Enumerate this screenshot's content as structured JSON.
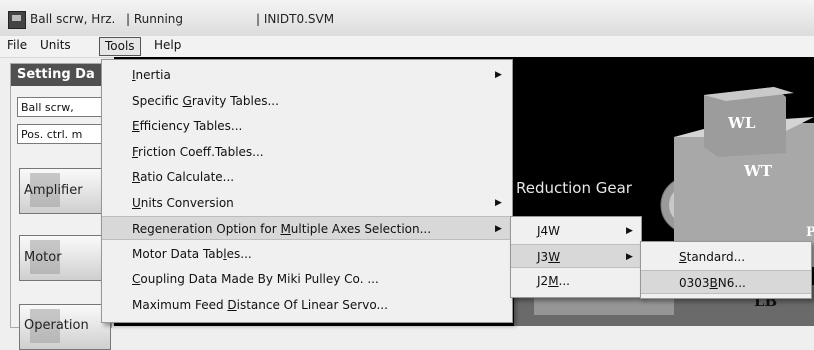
{
  "titlebar": {
    "app_name": "Ball scrw, Hrz.",
    "status": "| Running",
    "file": "| INIDT0.SVM"
  },
  "menubar": {
    "items": [
      "File",
      "Units",
      "Tools",
      "Help"
    ]
  },
  "panel": {
    "header": "Setting Da",
    "combo1": "Ball scrw,",
    "combo2": "Pos. ctrl. m",
    "buttons": [
      "Amplifier",
      "Motor",
      "Operation"
    ]
  },
  "scene": {
    "reduction_gear": "Reduction Gear",
    "wl": "WL",
    "wt": "WT",
    "lb": "LB",
    "partial_p": "P"
  },
  "tools_menu": {
    "items": [
      {
        "pre": "",
        "ul": "I",
        "post": "nertia",
        "submenu": true
      },
      {
        "pre": "Specific ",
        "ul": "G",
        "post": "ravity Tables...",
        "submenu": false
      },
      {
        "pre": "",
        "ul": "E",
        "post": "fficiency Tables...",
        "submenu": false
      },
      {
        "pre": "",
        "ul": "F",
        "post": "riction Coeff.Tables...",
        "submenu": false
      },
      {
        "pre": "",
        "ul": "R",
        "post": "atio Calculate...",
        "submenu": false
      },
      {
        "pre": "",
        "ul": "U",
        "post": "nits Conversion",
        "submenu": true
      },
      {
        "pre": "Regeneration Option for ",
        "ul": "M",
        "post": "ultiple Axes Selection...",
        "submenu": true
      },
      {
        "pre": "Motor Data Tab",
        "ul": "l",
        "post": "es...",
        "submenu": false
      },
      {
        "pre": "",
        "ul": "C",
        "post": "oupling Data Made By Miki Pulley Co. ...",
        "submenu": false
      },
      {
        "pre": "Maximum Feed ",
        "ul": "D",
        "post": "istance Of Linear Servo...",
        "submenu": false
      }
    ]
  },
  "regen_submenu": {
    "items": [
      {
        "pre": "",
        "ul": "J",
        "post": "4W",
        "submenu": true
      },
      {
        "pre": "J3",
        "ul": "W",
        "post": "",
        "submenu": true
      },
      {
        "pre": "J2",
        "ul": "M",
        "post": "...",
        "submenu": false
      }
    ]
  },
  "j3w_submenu": {
    "items": [
      {
        "pre": "",
        "ul": "S",
        "post": "tandard..."
      },
      {
        "pre": "0303",
        "ul": "B",
        "post": "N6..."
      }
    ]
  }
}
